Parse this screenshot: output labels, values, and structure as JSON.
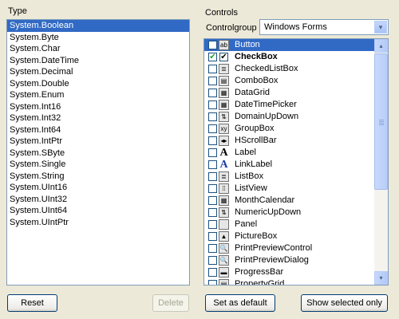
{
  "type_panel": {
    "label": "Type",
    "items": [
      "System.Boolean",
      "System.Byte",
      "System.Char",
      "System.DateTime",
      "System.Decimal",
      "System.Double",
      "System.Enum",
      "System.Int16",
      "System.Int32",
      "System.Int64",
      "System.IntPtr",
      "System.SByte",
      "System.Single",
      "System.String",
      "System.UInt16",
      "System.UInt32",
      "System.UInt64",
      "System.UIntPtr"
    ],
    "selected_index": 0
  },
  "controls_panel": {
    "label": "Controls",
    "group_label": "Controlgroup",
    "group_value": "Windows Forms",
    "items": [
      {
        "name": "Button",
        "icon": "ab",
        "checked": false,
        "selected": true
      },
      {
        "name": "CheckBox",
        "icon": "✔",
        "checked": true,
        "bold": true
      },
      {
        "name": "CheckedListBox",
        "icon": "≣",
        "checked": false
      },
      {
        "name": "ComboBox",
        "icon": "▤",
        "checked": false
      },
      {
        "name": "DataGrid",
        "icon": "▦",
        "checked": false
      },
      {
        "name": "DateTimePicker",
        "icon": "▦",
        "checked": false
      },
      {
        "name": "DomainUpDown",
        "icon": "⇅",
        "checked": false
      },
      {
        "name": "GroupBox",
        "icon": "xy",
        "checked": false
      },
      {
        "name": "HScrollBar",
        "icon": "◂▸",
        "checked": false
      },
      {
        "name": "Label",
        "icon": "A",
        "checked": false
      },
      {
        "name": "LinkLabel",
        "icon": "A",
        "checked": false
      },
      {
        "name": "ListBox",
        "icon": "≣",
        "checked": false
      },
      {
        "name": "ListView",
        "icon": "⁞⁞",
        "checked": false
      },
      {
        "name": "MonthCalendar",
        "icon": "▦",
        "checked": false
      },
      {
        "name": "NumericUpDown",
        "icon": "⇅",
        "checked": false
      },
      {
        "name": "Panel",
        "icon": "",
        "checked": false
      },
      {
        "name": "PictureBox",
        "icon": "▲",
        "checked": false
      },
      {
        "name": "PrintPreviewControl",
        "icon": "🔍",
        "checked": false
      },
      {
        "name": "PrintPreviewDialog",
        "icon": "🔍",
        "checked": false
      },
      {
        "name": "ProgressBar",
        "icon": "▬",
        "checked": false
      },
      {
        "name": "PropertyGrid",
        "icon": "▤",
        "checked": false
      }
    ]
  },
  "buttons": {
    "reset": "Reset",
    "delete": "Delete",
    "set_default": "Set as default",
    "show_selected": "Show selected only"
  },
  "icons": {
    "checkmark": "✔",
    "dropdown": "▾",
    "scroll_up": "▴",
    "scroll_down": "▾"
  }
}
